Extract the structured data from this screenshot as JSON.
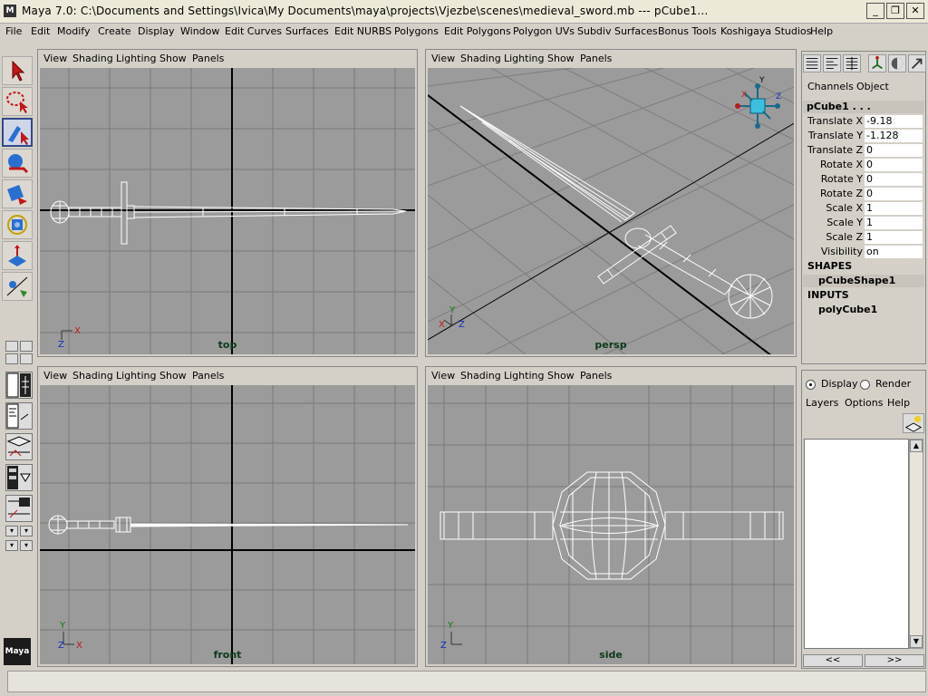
{
  "window": {
    "title": "Maya 7.0: C:\\Documents and Settings\\Ivica\\My Documents\\maya\\projects\\Vjezbe\\scenes\\medieval_sword.mb   ---   pCube1...",
    "logo": "M",
    "minimize": "_",
    "restore": "❐",
    "close": "✕"
  },
  "menubar": [
    "File",
    "Edit",
    "Modify",
    "Create",
    "Display",
    "Window",
    "Edit Curves",
    "Surfaces",
    "Edit NURBS",
    "Polygons",
    "Edit Polygons",
    "Polygon UVs",
    "Subdiv Surfaces",
    "Bonus Tools",
    "Koshigaya Studios",
    "Help"
  ],
  "viewport_menu": [
    "View",
    "Shading",
    "Lighting",
    "Show",
    "Panels"
  ],
  "viewports": {
    "top": {
      "name": "top"
    },
    "persp": {
      "name": "persp"
    },
    "front": {
      "name": "front"
    },
    "side": {
      "name": "side"
    }
  },
  "axes": {
    "top": {
      "a": "X",
      "b": "Z"
    },
    "persp": {
      "a": "X",
      "b": "Y",
      "c": "Z"
    },
    "front": {
      "a": "Y",
      "b": "X",
      "c": "Z"
    },
    "side": {
      "a": "Y",
      "b": "Z"
    }
  },
  "channel_box": {
    "tabs": [
      "Channels",
      "Object"
    ],
    "object_name": "pCube1 . . .",
    "attributes": [
      {
        "label": "Translate X",
        "value": "-9.18"
      },
      {
        "label": "Translate Y",
        "value": "-1.128"
      },
      {
        "label": "Translate Z",
        "value": "0"
      },
      {
        "label": "Rotate X",
        "value": "0"
      },
      {
        "label": "Rotate Y",
        "value": "0"
      },
      {
        "label": "Rotate Z",
        "value": "0"
      },
      {
        "label": "Scale X",
        "value": "1"
      },
      {
        "label": "Scale Y",
        "value": "1"
      },
      {
        "label": "Scale Z",
        "value": "1"
      },
      {
        "label": "Visibility",
        "value": "on"
      }
    ],
    "shapes_header": "SHAPES",
    "shape_name": "pCubeShape1",
    "inputs_header": "INPUTS",
    "input_name": "polyCube1"
  },
  "layer_editor": {
    "display_label": "Display",
    "render_label": "Render",
    "menu": [
      "Layers",
      "Options",
      "Help"
    ],
    "prev": "<<",
    "next": ">>"
  },
  "maya_logo": "Maya",
  "colors": {
    "viewport_bg": "#9b9b9b",
    "grid": "#7a7a7a",
    "axis": "#000000",
    "wire": "#ffffff",
    "view_label": "#0d3a1a"
  }
}
